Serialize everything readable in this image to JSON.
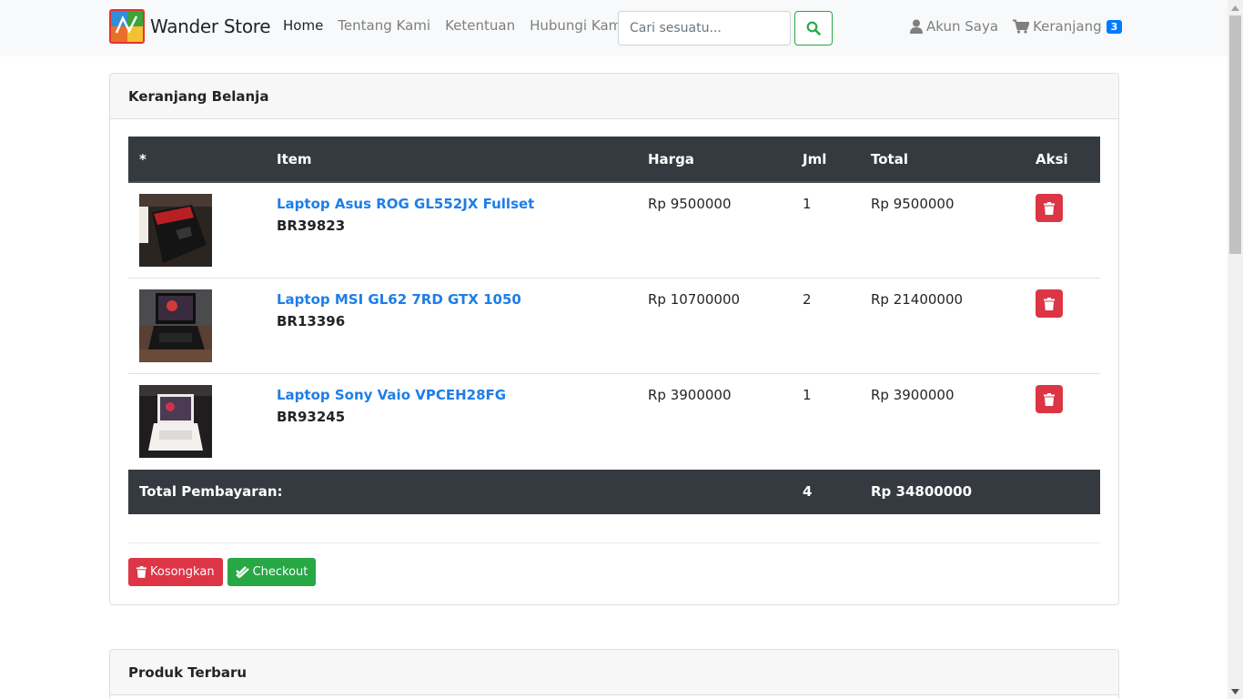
{
  "brand": {
    "name": "Wander Store"
  },
  "nav": {
    "links": [
      {
        "label": "Home"
      },
      {
        "label": "Tentang Kami"
      },
      {
        "label": "Ketentuan"
      },
      {
        "label": "Hubungi Kami"
      }
    ]
  },
  "search": {
    "placeholder": "Cari sesuatu...",
    "value": ""
  },
  "account": {
    "label": "Akun Saya"
  },
  "cart_nav": {
    "label": "Keranjang",
    "count": "3"
  },
  "cart": {
    "title": "Keranjang Belanja",
    "columns": {
      "index": "*",
      "item": "Item",
      "price": "Harga",
      "qty": "Jml",
      "total": "Total",
      "action": "Aksi"
    },
    "rows": [
      {
        "name": "Laptop Asus ROG GL552JX Fullset",
        "code": "BR39823",
        "price": "Rp 9500000",
        "qty": "1",
        "total": "Rp 9500000"
      },
      {
        "name": "Laptop MSI GL62 7RD GTX 1050",
        "code": "BR13396",
        "price": "Rp 10700000",
        "qty": "2",
        "total": "Rp 21400000"
      },
      {
        "name": "Laptop Sony Vaio VPCEH28FG",
        "code": "BR93245",
        "price": "Rp 3900000",
        "qty": "1",
        "total": "Rp 3900000"
      }
    ],
    "footer": {
      "label": "Total Pembayaran:",
      "qty": "4",
      "total": "Rp 34800000"
    },
    "buttons": {
      "empty": "Kosongkan",
      "checkout": "Checkout"
    }
  },
  "latest": {
    "title": "Produk Terbaru"
  },
  "colors": {
    "primary": "#007bff",
    "link": "#1e7ee6",
    "danger": "#dc3545",
    "success": "#28a745",
    "dark": "#343a40"
  },
  "icons": {
    "user": "user-icon",
    "cart": "shopping-cart-icon",
    "search": "search-icon",
    "trash": "trash-icon",
    "check": "check-double-icon"
  }
}
